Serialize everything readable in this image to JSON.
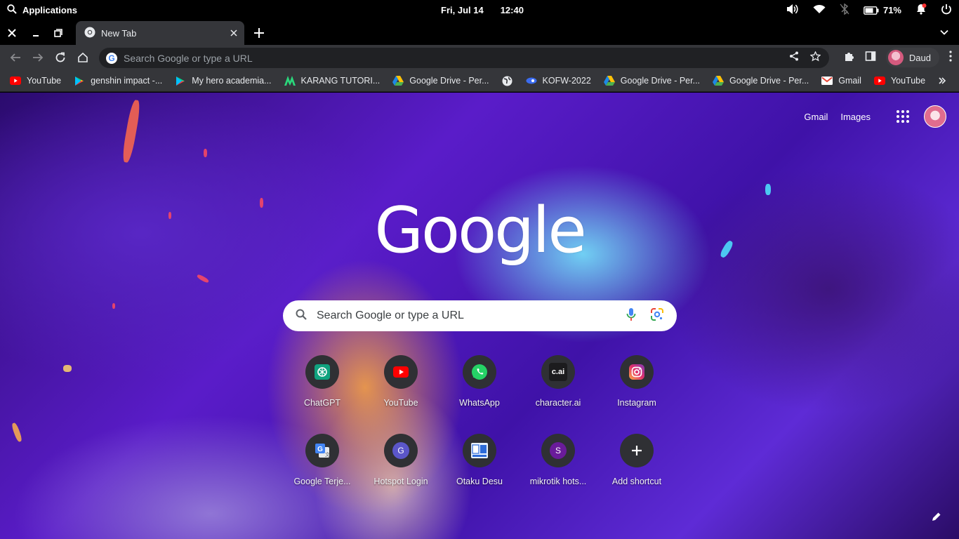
{
  "os_bar": {
    "apps_label": "Applications",
    "date": "Fri, Jul 14",
    "time": "12:40",
    "battery_percent": "71%"
  },
  "browser": {
    "active_tab": {
      "title": "New Tab"
    },
    "omnibox": {
      "placeholder": "Search Google or type a URL"
    },
    "profile_name": "Daud"
  },
  "bookmarks": [
    {
      "label": "YouTube",
      "icon": "youtube-icon"
    },
    {
      "label": "genshin impact -...",
      "icon": "play-store-icon"
    },
    {
      "label": "My hero academia...",
      "icon": "play-store-icon"
    },
    {
      "label": "KARANG TUTORI...",
      "icon": "karang-icon"
    },
    {
      "label": "Google Drive - Per...",
      "icon": "google-drive-icon"
    },
    {
      "label": "",
      "icon": "globe-icon"
    },
    {
      "label": "KOFW-2022",
      "icon": "kofw-icon"
    },
    {
      "label": "Google Drive - Per...",
      "icon": "google-drive-icon"
    },
    {
      "label": "Google Drive - Per...",
      "icon": "google-drive-icon"
    },
    {
      "label": "Gmail",
      "icon": "gmail-icon"
    },
    {
      "label": "YouTube",
      "icon": "youtube-icon"
    }
  ],
  "ntp": {
    "gmail_link": "Gmail",
    "images_link": "Images",
    "logo_text": "Google",
    "search_placeholder": "Search Google or type a URL",
    "shortcuts": [
      {
        "label": "ChatGPT",
        "icon": "chatgpt-icon"
      },
      {
        "label": "YouTube",
        "icon": "youtube-icon"
      },
      {
        "label": "WhatsApp",
        "icon": "whatsapp-icon"
      },
      {
        "label": "character.ai",
        "icon": "character-ai-icon",
        "glyph": "c.ai"
      },
      {
        "label": "Instagram",
        "icon": "instagram-icon"
      },
      {
        "label": "Google Terje...",
        "icon": "google-translate-icon"
      },
      {
        "label": "Hotspot Login",
        "icon": "letter-g-icon",
        "glyph": "G"
      },
      {
        "label": "Otaku Desu",
        "icon": "otaku-desu-icon"
      },
      {
        "label": "mikrotik hots...",
        "icon": "letter-s-icon",
        "glyph": "S"
      },
      {
        "label": "Add shortcut",
        "icon": "plus-icon"
      }
    ]
  },
  "colors": {
    "toolbar": "#35363a",
    "omnibox": "#202124",
    "shortcut_circle": "#2f3034",
    "wallpaper_primary": "#5a1cc9"
  }
}
